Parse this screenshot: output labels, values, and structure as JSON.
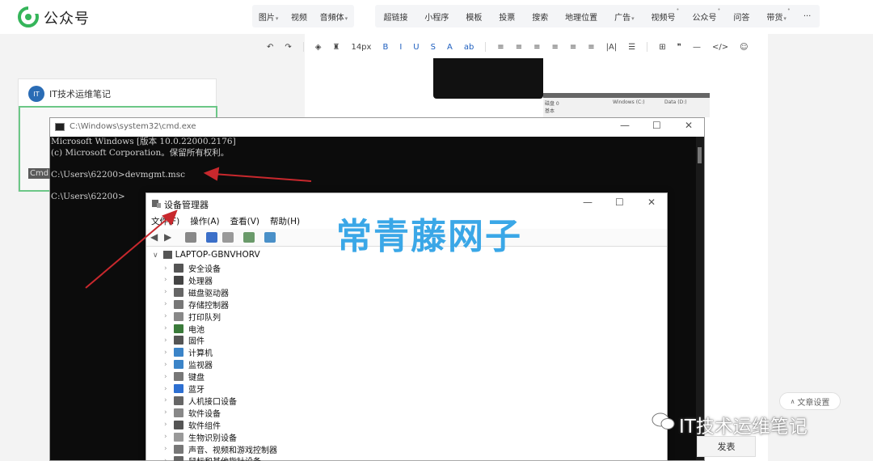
{
  "brand": {
    "name": "公众号"
  },
  "top_menu": {
    "group1": [
      {
        "label": "图片",
        "dropdown": true
      },
      {
        "label": "视频",
        "dropdown": false
      },
      {
        "label": "音頻体",
        "dropdown": true
      }
    ],
    "group2": [
      {
        "label": "超链接",
        "dropdown": false,
        "dot": false
      },
      {
        "label": "小程序",
        "dropdown": false,
        "dot": false
      },
      {
        "label": "模板",
        "dropdown": false,
        "dot": false
      },
      {
        "label": "投票",
        "dropdown": false,
        "dot": false
      },
      {
        "label": "搜索",
        "dropdown": false,
        "dot": false
      },
      {
        "label": "地理位置",
        "dropdown": false,
        "dot": false
      },
      {
        "label": "广告",
        "dropdown": true,
        "dot": false
      },
      {
        "label": "视频号",
        "dropdown": false,
        "dot": true
      },
      {
        "label": "公众号",
        "dropdown": false,
        "dot": true
      },
      {
        "label": "问答",
        "dropdown": false,
        "dot": false
      },
      {
        "label": "带货",
        "dropdown": true,
        "dot": true
      },
      {
        "label": "···",
        "dropdown": false,
        "dot": false
      }
    ]
  },
  "editor_toolbar": {
    "font_size": "14px",
    "items": [
      "↶",
      "↷",
      "◈",
      "♜",
      "B",
      "I",
      "U",
      "S",
      "A",
      "ab",
      "≡",
      "≡",
      "≡",
      "≡",
      "≡",
      "≡",
      "|A|",
      "☰",
      "⊞",
      "❞",
      "—",
      "</>",
      "☺"
    ]
  },
  "account_card": {
    "avatar_text": "IT",
    "name": "IT技术运维笔记"
  },
  "thumb_table": {
    "cells": [
      "磁盘 0",
      "Windows (C:)",
      "Data (D:)",
      "基本"
    ]
  },
  "cmd_window": {
    "title": "C:\\Windows\\system32\\cmd.exe",
    "lines": [
      "Microsoft Windows [版本 10.0.22000.2176]",
      "(c) Microsoft Corporation。保留所有权利。",
      "",
      "C:\\Users\\62200>devmgmt.msc",
      "",
      "C:\\Users\\62200>"
    ],
    "ghost_label": "Cmd"
  },
  "device_manager": {
    "title": "设备管理器",
    "menu": [
      "文件(F)",
      "操作(A)",
      "查看(V)",
      "帮助(H)"
    ],
    "root": "LAPTOP-GBNVHORV",
    "items": [
      {
        "label": "安全设备",
        "icon_color": "#555"
      },
      {
        "label": "处理器",
        "icon_color": "#444"
      },
      {
        "label": "磁盘驱动器",
        "icon_color": "#666"
      },
      {
        "label": "存储控制器",
        "icon_color": "#777"
      },
      {
        "label": "打印队列",
        "icon_color": "#888"
      },
      {
        "label": "电池",
        "icon_color": "#3a7a3a"
      },
      {
        "label": "固件",
        "icon_color": "#555"
      },
      {
        "label": "计算机",
        "icon_color": "#3b84c8"
      },
      {
        "label": "监视器",
        "icon_color": "#3b84c8"
      },
      {
        "label": "键盘",
        "icon_color": "#777"
      },
      {
        "label": "蓝牙",
        "icon_color": "#2d6fd1"
      },
      {
        "label": "人机接口设备",
        "icon_color": "#666"
      },
      {
        "label": "软件设备",
        "icon_color": "#888"
      },
      {
        "label": "软件组件",
        "icon_color": "#555"
      },
      {
        "label": "生物识别设备",
        "icon_color": "#999"
      },
      {
        "label": "声音、视频和游戏控制器",
        "icon_color": "#777"
      },
      {
        "label": "鼠标和其他指针设备",
        "icon_color": "#666"
      }
    ]
  },
  "watermark": {
    "text": "常青藤网子",
    "color": "#2aa0e6"
  },
  "bottom": {
    "article_settings": "文章设置",
    "publish": "发表",
    "channel_watermark": "IT技术运维笔记"
  },
  "colors": {
    "arrow": "#c8282d",
    "selection_border": "#6cc787"
  }
}
